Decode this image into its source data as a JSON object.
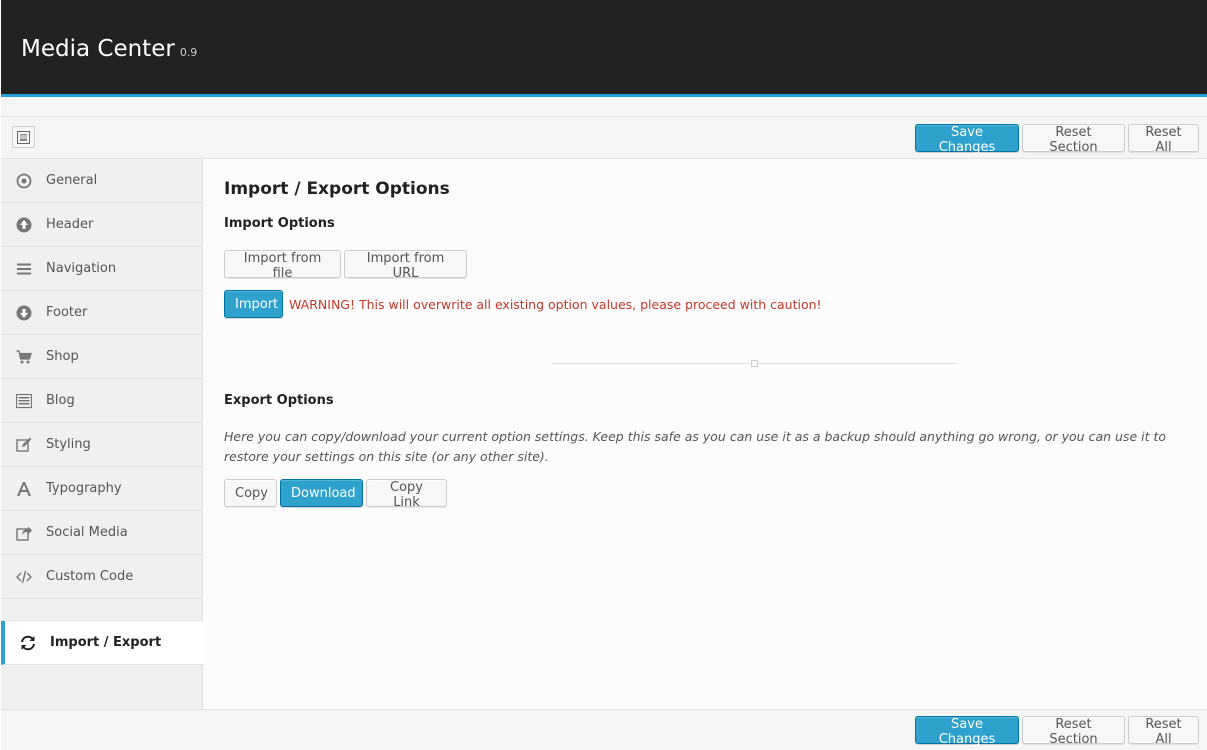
{
  "header": {
    "title": "Media Center",
    "version": "0.9"
  },
  "toolbar": {
    "save_label": "Save Changes",
    "reset_section_label": "Reset Section",
    "reset_all_label": "Reset All"
  },
  "sidebar": {
    "items": [
      {
        "label": "General",
        "icon": "circle-dot-icon"
      },
      {
        "label": "Header",
        "icon": "arrow-up-circle-icon"
      },
      {
        "label": "Navigation",
        "icon": "menu-icon"
      },
      {
        "label": "Footer",
        "icon": "arrow-down-circle-icon"
      },
      {
        "label": "Shop",
        "icon": "cart-icon"
      },
      {
        "label": "Blog",
        "icon": "list-icon"
      },
      {
        "label": "Styling",
        "icon": "edit-icon"
      },
      {
        "label": "Typography",
        "icon": "font-icon"
      },
      {
        "label": "Social Media",
        "icon": "share-icon"
      },
      {
        "label": "Custom Code",
        "icon": "code-icon"
      },
      {
        "label": "Import / Export",
        "icon": "refresh-icon",
        "active": true
      }
    ]
  },
  "main": {
    "title": "Import / Export Options",
    "import": {
      "heading": "Import Options",
      "from_file_label": "Import from file",
      "from_url_label": "Import from URL",
      "import_label": "Import",
      "warning": "WARNING! This will overwrite all existing option values, please proceed with caution!"
    },
    "export": {
      "heading": "Export Options",
      "description": "Here you can copy/download your current option settings. Keep this safe as you can use it as a backup should anything go wrong, or you can use it to restore your settings on this site (or any other site).",
      "copy_label": "Copy",
      "download_label": "Download",
      "copy_link_label": "Copy Link"
    }
  },
  "footer": {
    "save_label": "Save Changes",
    "reset_section_label": "Reset Section",
    "reset_all_label": "Reset All"
  },
  "colors": {
    "accent": "#2ea2cc",
    "warning": "#c0392b",
    "header_bg": "#222222"
  }
}
